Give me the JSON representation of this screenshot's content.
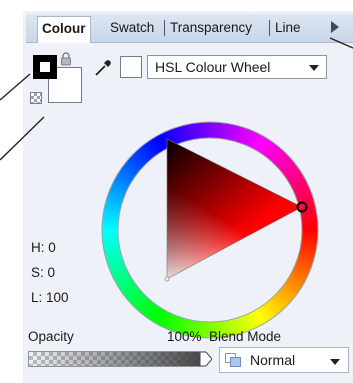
{
  "tabs": [
    {
      "label": "Colour",
      "active": true
    },
    {
      "label": "Swatch",
      "active": false
    },
    {
      "label": "Transparency",
      "active": false
    },
    {
      "label": "Line",
      "active": false
    }
  ],
  "colour_mode": {
    "selected": "HSL Colour Wheel"
  },
  "hsl": {
    "h": "H: 0",
    "s": "S: 0",
    "l": "L: 100"
  },
  "opacity": {
    "label": "Opacity",
    "value_text": "100%",
    "value": 100
  },
  "blend": {
    "label": "Blend Mode",
    "selected": "Normal"
  },
  "colors": {
    "current": "#ffffff",
    "wheel_hue": "#ff0000",
    "tab_bar": "#c9d6e8"
  },
  "icons": [
    "lock-icon",
    "transparency-toggle-icon",
    "eyedropper-icon",
    "chevron-down-icon",
    "tab-scroll-arrow-icon",
    "blend-mode-icon"
  ]
}
